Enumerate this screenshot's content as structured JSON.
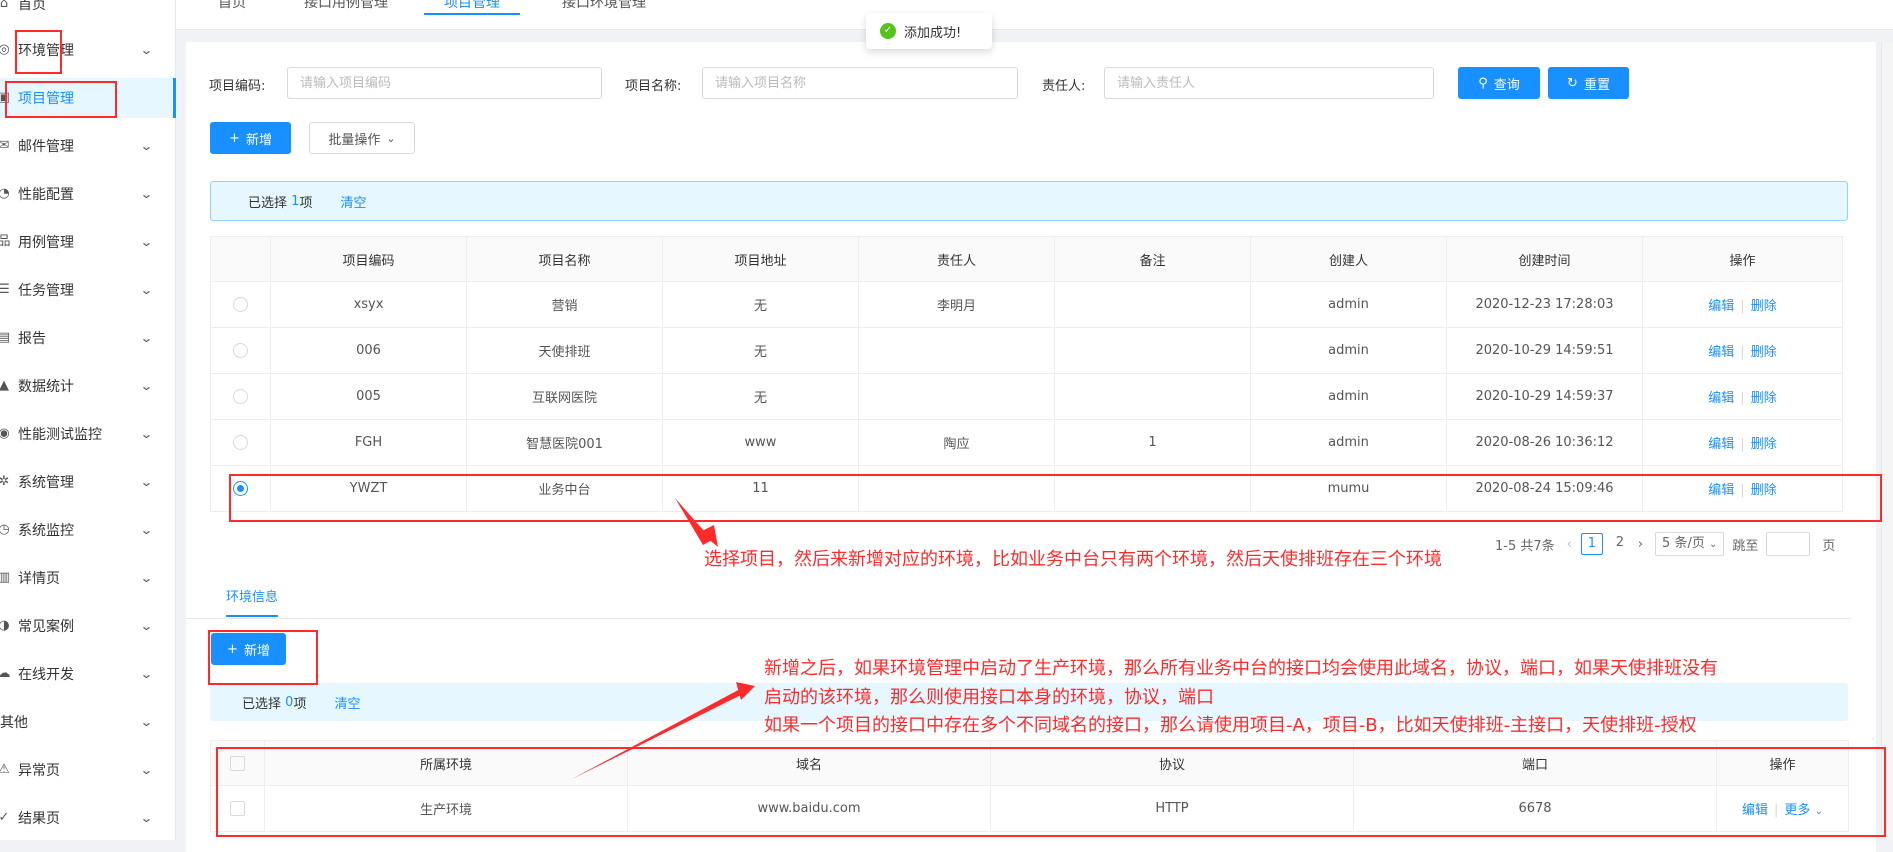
{
  "sidebar": {
    "items": [
      {
        "label": "首页",
        "icon": "home-icon"
      },
      {
        "label": "环境管理",
        "icon": "globe-icon"
      },
      {
        "label": "项目管理",
        "icon": "project-icon"
      },
      {
        "label": "邮件管理",
        "icon": "mail-icon"
      },
      {
        "label": "性能配置",
        "icon": "performance-icon"
      },
      {
        "label": "用例管理",
        "icon": "case-icon"
      },
      {
        "label": "任务管理",
        "icon": "task-icon"
      },
      {
        "label": "报告",
        "icon": "report-icon"
      },
      {
        "label": "数据统计",
        "icon": "chart-icon"
      },
      {
        "label": "性能测试监控",
        "icon": "eye-icon"
      },
      {
        "label": "系统管理",
        "icon": "settings-icon"
      },
      {
        "label": "系统监控",
        "icon": "dashboard-icon"
      },
      {
        "label": "详情页",
        "icon": "detail-icon"
      },
      {
        "label": "常见案例",
        "icon": "case-study-icon"
      },
      {
        "label": "在线开发",
        "icon": "cloud-icon"
      },
      {
        "label": "其他",
        "icon": "none"
      },
      {
        "label": "异常页",
        "icon": "warning-icon"
      },
      {
        "label": "结果页",
        "icon": "check-circle-icon"
      }
    ]
  },
  "tabs": [
    "首页",
    "接口用例管理",
    "项目管理",
    "接口环境管理"
  ],
  "toast": {
    "text": "添加成功!"
  },
  "search": {
    "code_label": "项目编码:",
    "code_placeholder": "请输入项目编码",
    "name_label": "项目名称:",
    "name_placeholder": "请输入项目名称",
    "owner_label": "责任人:",
    "owner_placeholder": "请输入责任人",
    "query_label": "查询",
    "reset_label": "重置"
  },
  "toolbar": {
    "add_label": "新增",
    "batch_label": "批量操作"
  },
  "selection": {
    "prefix": "已选择",
    "count": "1",
    "suffix": "项",
    "clear": "清空"
  },
  "table": {
    "columns": [
      "项目编码",
      "项目名称",
      "项目地址",
      "责任人",
      "备注",
      "创建人",
      "创建时间",
      "操作"
    ],
    "rows": [
      {
        "code": "xsyx",
        "name": "营销",
        "addr": "无",
        "owner": "李明月",
        "remark": "",
        "creator": "admin",
        "time": "2020-12-23 17:28:03"
      },
      {
        "code": "006",
        "name": "天使排班",
        "addr": "无",
        "owner": "",
        "remark": "",
        "creator": "admin",
        "time": "2020-10-29 14:59:51"
      },
      {
        "code": "005",
        "name": "互联网医院",
        "addr": "无",
        "owner": "",
        "remark": "",
        "creator": "admin",
        "time": "2020-10-29 14:59:37"
      },
      {
        "code": "FGH",
        "name": "智慧医院001",
        "addr": "www",
        "owner": "陶应",
        "remark": "1",
        "creator": "admin",
        "time": "2020-08-26 10:36:12"
      },
      {
        "code": "YWZT",
        "name": "业务中台",
        "addr": "11",
        "owner": "",
        "remark": "",
        "creator": "mumu",
        "time": "2020-08-24 15:09:46"
      }
    ],
    "edit": "编辑",
    "delete": "删除",
    "selected_row": 4
  },
  "pager": {
    "total": "1-5 共7条",
    "pages": [
      "1",
      "2"
    ],
    "current": "1",
    "size": "5 条/页",
    "jump": "跳至",
    "page_suffix": "页"
  },
  "env": {
    "tab": "环境信息",
    "add_label": "新增",
    "selection": {
      "prefix": "已选择",
      "count": "0",
      "suffix": "项",
      "clear": "清空"
    },
    "columns": [
      "所属环境",
      "域名",
      "协议",
      "端口",
      "操作"
    ],
    "rows": [
      {
        "env": "生产环境",
        "domain": "www.baidu.com",
        "protocol": "HTTP",
        "port": "6678"
      }
    ],
    "edit": "编辑",
    "more": "更多"
  },
  "notes": {
    "note1": "选择项目，然后来新增对应的环境，比如业务中台只有两个环境，然后天使排班存在三个环境",
    "note2_line1": "新增之后，如果环境管理中启动了生产环境，那么所有业务中台的接口均会使用此域名，协议，端口，如果天使排班没有",
    "note2_line2": "启动的该环境，那么则使用接口本身的环境，协议，端口",
    "note2_line3": "如果一个项目的接口中存在多个不同域名的接口，那么请使用项目-A，项目-B，比如天使排班-主接口，天使排班-授权"
  },
  "colors": {
    "accent": "#1890ff",
    "annotation": "#ff2a2a",
    "success": "#52c41a"
  }
}
